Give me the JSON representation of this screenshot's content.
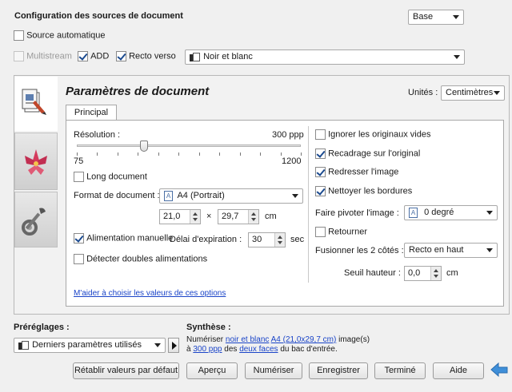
{
  "sources": {
    "title": "Configuration des sources de document",
    "mode_select": "Base",
    "auto_source": "Source automatique",
    "multistream": "Multistream",
    "add": "ADD",
    "duplex": "Recto verso",
    "color_select": "Noir et blanc"
  },
  "panel": {
    "title": "Paramètres de document",
    "units_label": "Unités :",
    "units_value": "Centimètres",
    "tab_principal": "Principal"
  },
  "left": {
    "resolution_label": "Résolution :",
    "resolution_value": "300 ppp",
    "slider_min": "75",
    "slider_max": "1200",
    "slider_fraction": 0.3,
    "long_document": "Long document",
    "format_label": "Format de document :",
    "format_value": "A4 (Portrait)",
    "width_value": "21,0",
    "times": "×",
    "height_value": "29,7",
    "size_unit": "cm",
    "manual_feed": "Alimentation manuelle",
    "timeout_label": "Délai d'expiration :",
    "timeout_value": "30",
    "timeout_unit": "sec",
    "double_feed": "Détecter doubles alimentations",
    "help_link": "M'aider à choisir les valeurs de ces options"
  },
  "right": {
    "ignore_blank": "Ignorer les originaux vides",
    "crop": "Recadrage sur l'original",
    "straighten": "Redresser l'image",
    "clean_borders": "Nettoyer les bordures",
    "rotate_label": "Faire pivoter l'image :",
    "rotate_value": "0 degré",
    "flip": "Retourner",
    "merge_label": "Fusionner les 2 côtés :",
    "merge_value": "Recto en haut",
    "threshold_label": "Seuil hauteur :",
    "threshold_value": "0,0",
    "threshold_unit": "cm"
  },
  "presets": {
    "label": "Préréglages :",
    "value": "Derniers paramètres utilisés"
  },
  "summary": {
    "label": "Synthèse :",
    "scan": "Numériser",
    "color_link": "noir et blanc",
    "size_link": "A4 (21,0x29,7 cm)",
    "images": "image(s)",
    "at": "à",
    "dpi_link": "300 ppp",
    "of": "des",
    "sides_link": "deux faces",
    "tray": "du bac d'entrée."
  },
  "buttons": {
    "reset": "Rétablir valeurs par défaut",
    "preview": "Aperçu",
    "scan": "Numériser",
    "save": "Enregistrer",
    "done": "Terminé",
    "help": "Aide"
  },
  "colors": {
    "link": "#1a44c8",
    "check": "#1b4a8f",
    "panel_bg": "#ffffff"
  }
}
